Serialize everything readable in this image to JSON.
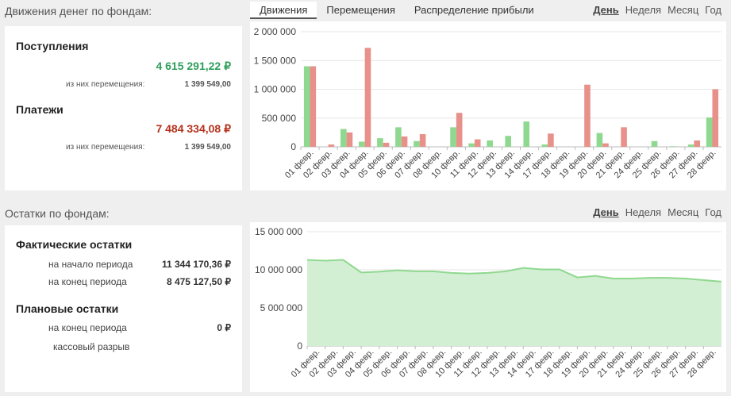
{
  "movements": {
    "title": "Движения денег по фондам:",
    "tabs": [
      "Движения",
      "Перемещения",
      "Распределение прибыли"
    ],
    "active_tab": "Движения",
    "period": [
      "День",
      "Неделя",
      "Месяц",
      "Год"
    ],
    "active_period": "День",
    "income_title": "Поступления",
    "income_amount": "4 615 291,22 ₽",
    "income_sub_label": "из них перемещения:",
    "income_sub_value": "1 399 549,00",
    "payments_title": "Платежи",
    "payments_amount": "7 484 334,08 ₽",
    "payments_sub_label": "из них перемещения:",
    "payments_sub_value": "1 399 549,00",
    "colors": {
      "income": "#2e9e5b",
      "payments": "#b5311c"
    }
  },
  "balances": {
    "title": "Остатки по фондам:",
    "period": [
      "День",
      "Неделя",
      "Месяц",
      "Год"
    ],
    "active_period": "День",
    "actual_title": "Фактические остатки",
    "start_label": "на начало периода",
    "start_value": "11 344 170,36 ₽",
    "end_label": "на конец периода",
    "end_value": "8 475 127,50 ₽",
    "plan_title": "Плановые остатки",
    "plan_end_label": "на конец периода",
    "plan_end_value": "0 ₽",
    "gap_label": "кассовый разрыв"
  },
  "chart_data": [
    {
      "type": "bar",
      "categories": [
        "01 февр.",
        "02 февр.",
        "03 февр.",
        "04 февр.",
        "05 февр.",
        "06 февр.",
        "07 февр.",
        "08 февр.",
        "10 февр.",
        "11 февр.",
        "12 февр.",
        "13 февр.",
        "14 февр.",
        "17 февр.",
        "18 февр.",
        "19 февр.",
        "20 февр.",
        "21 февр.",
        "24 февр.",
        "25 февр.",
        "26 февр.",
        "27 февр.",
        "28 февр."
      ],
      "series": [
        {
          "color": "#8fd88f",
          "values": [
            1400000,
            0,
            310000,
            90000,
            150000,
            340000,
            100000,
            0,
            340000,
            60000,
            110000,
            190000,
            440000,
            40000,
            0,
            0,
            240000,
            0,
            0,
            100000,
            10000,
            40000,
            510000
          ]
        },
        {
          "color": "#e8908a",
          "values": [
            1400000,
            40000,
            250000,
            1720000,
            70000,
            180000,
            220000,
            0,
            590000,
            130000,
            0,
            0,
            0,
            230000,
            0,
            1080000,
            60000,
            340000,
            0,
            0,
            0,
            110000,
            1000000
          ]
        }
      ],
      "yticks": [
        "2 000 000",
        "1 500 000",
        "1 000 000",
        "500 000",
        "0"
      ],
      "ylim": [
        0,
        2000000
      ],
      "grid": true
    },
    {
      "type": "area",
      "categories": [
        "01 февр.",
        "02 февр.",
        "03 февр.",
        "04 февр.",
        "05 февр.",
        "06 февр.",
        "07 февр.",
        "08 февр.",
        "10 февр.",
        "11 февр.",
        "12 февр.",
        "13 февр.",
        "14 февр.",
        "17 февр.",
        "18 февр.",
        "19 февр.",
        "20 февр.",
        "21 февр.",
        "24 февр.",
        "25 февр.",
        "26 февр.",
        "27 февр.",
        "28 февр."
      ],
      "values": [
        11300000,
        11200000,
        11300000,
        9650000,
        9750000,
        9950000,
        9800000,
        9800000,
        9600000,
        9500000,
        9600000,
        9800000,
        10250000,
        10050000,
        10050000,
        9000000,
        9200000,
        8850000,
        8850000,
        8950000,
        8950000,
        8850000,
        8450000
      ],
      "yticks": [
        "15 000 000",
        "10 000 000",
        "5 000 000",
        "0"
      ],
      "ylim": [
        0,
        15000000
      ],
      "grid": true
    }
  ]
}
